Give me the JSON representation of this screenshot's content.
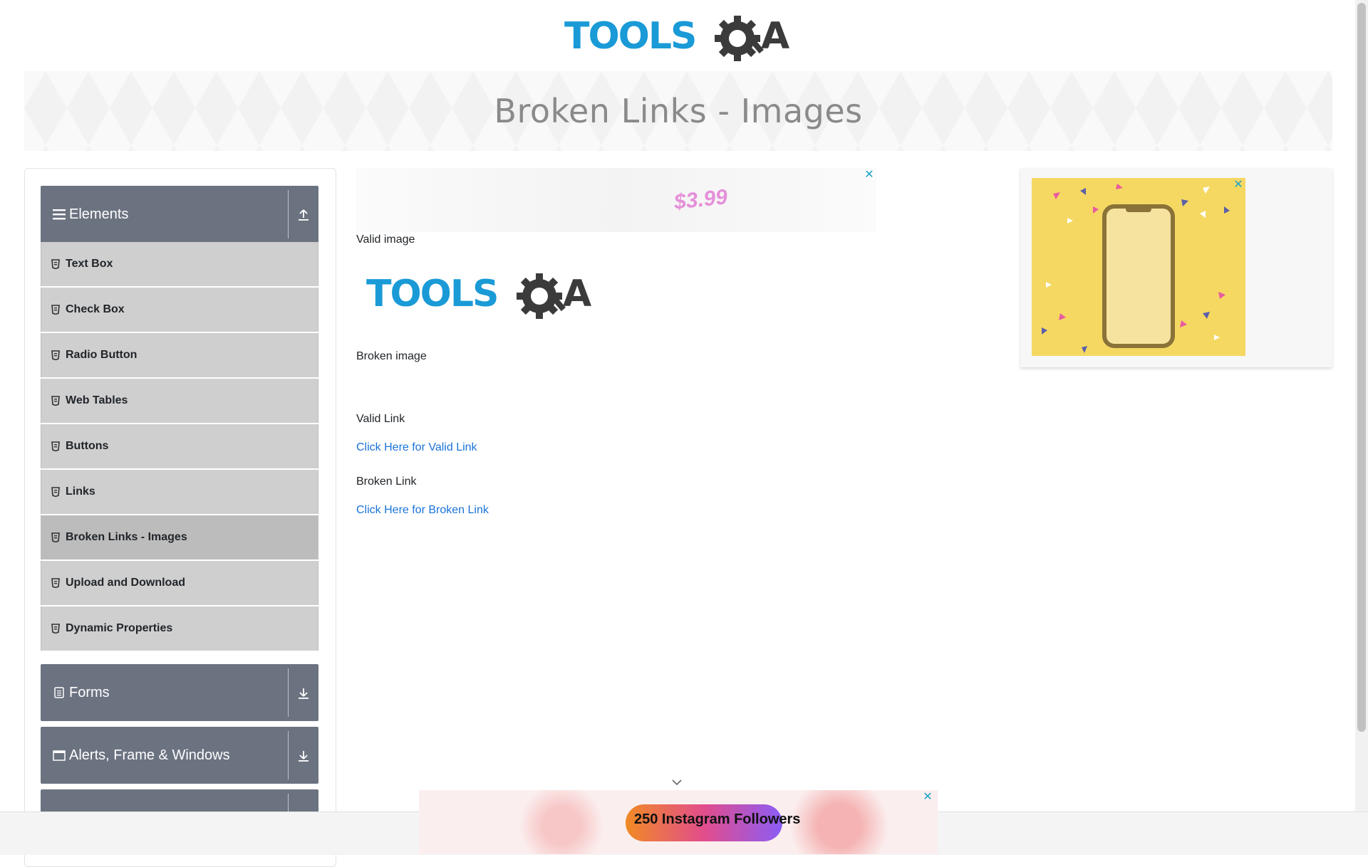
{
  "header": {
    "logo_text_tools": "TOOLS",
    "logo_text_qa": "QA"
  },
  "banner": {
    "title": "Broken Links - Images"
  },
  "sidebar": {
    "groups": [
      {
        "label": "Elements",
        "icon": "hamburger-icon",
        "toggle_icon": "collapse-up-icon",
        "expanded": true
      },
      {
        "label": "Forms",
        "icon": "form-icon",
        "toggle_icon": "expand-down-icon",
        "expanded": false
      },
      {
        "label": "Alerts, Frame & Windows",
        "icon": "window-icon",
        "toggle_icon": "expand-down-icon",
        "expanded": false
      }
    ],
    "items": [
      {
        "label": "Text Box"
      },
      {
        "label": "Check Box"
      },
      {
        "label": "Radio Button"
      },
      {
        "label": "Web Tables"
      },
      {
        "label": "Buttons"
      },
      {
        "label": "Links"
      },
      {
        "label": "Broken Links - Images",
        "active": true
      },
      {
        "label": "Upload and Download"
      },
      {
        "label": "Dynamic Properties"
      }
    ]
  },
  "main": {
    "ad_price": "$3.99",
    "valid_image_label": "Valid image",
    "broken_image_label": "Broken image",
    "valid_link_label": "Valid Link",
    "valid_link_text": "Click Here for Valid Link",
    "broken_link_label": "Broken Link",
    "broken_link_text": "Click Here for Broken Link"
  },
  "ads": {
    "bottom_text": "250 Instagram Followers",
    "close_glyph": "✕"
  },
  "colors": {
    "logo_blue": "#1a9ad6",
    "logo_dark": "#3b3b3b",
    "group_header_bg": "#6b7280",
    "menu_item_bg": "#cfcfcf",
    "link": "#1a73d9"
  }
}
